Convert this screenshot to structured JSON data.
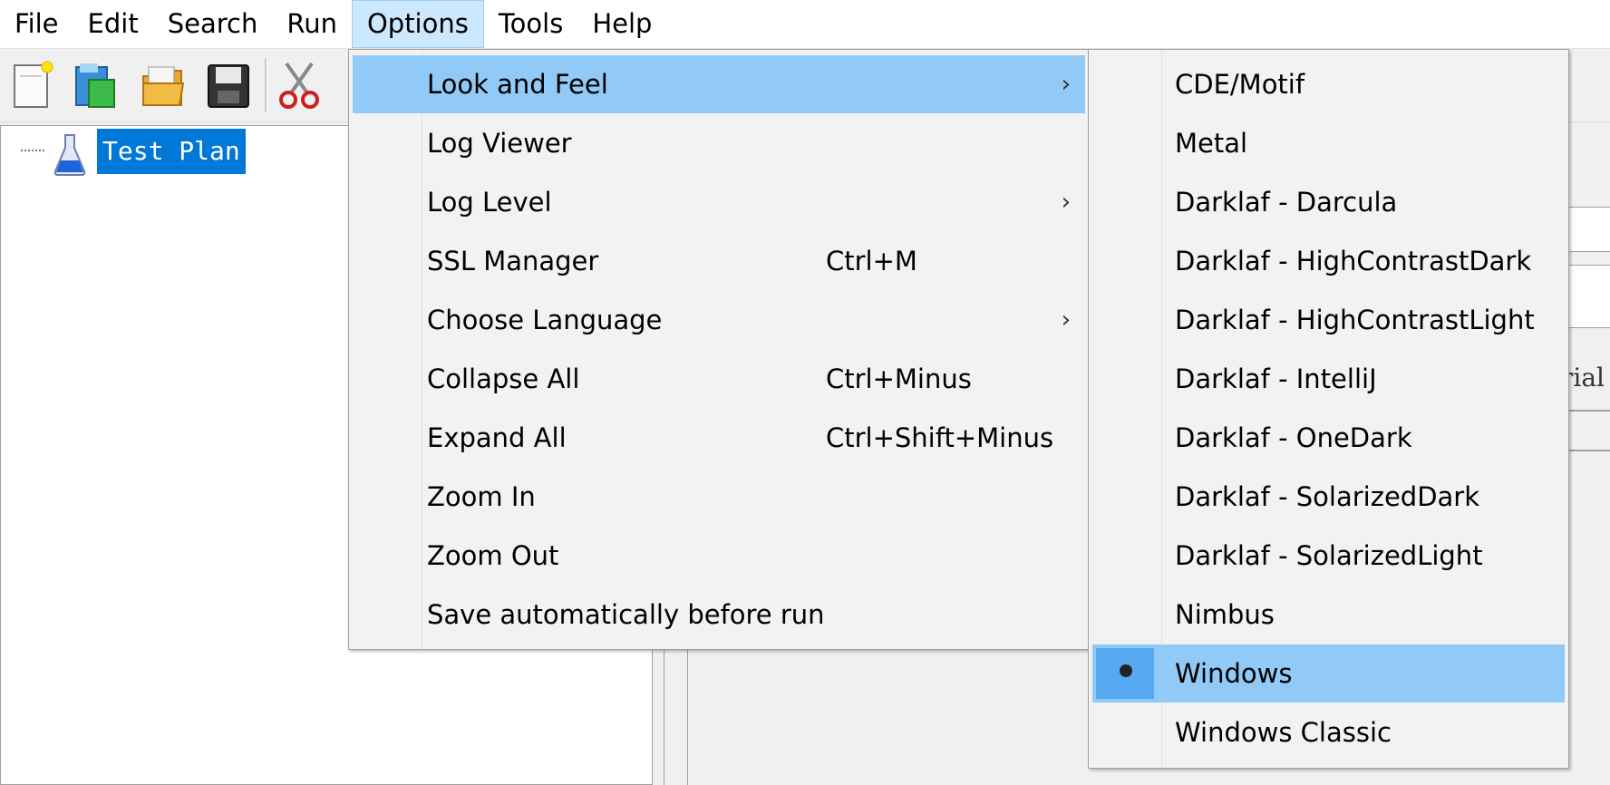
{
  "menubar": {
    "items": [
      {
        "label": "File"
      },
      {
        "label": "Edit"
      },
      {
        "label": "Search"
      },
      {
        "label": "Run"
      },
      {
        "label": "Options"
      },
      {
        "label": "Tools"
      },
      {
        "label": "Help"
      }
    ],
    "open_item": "Options"
  },
  "toolbar": {
    "icons": [
      "new-document-icon",
      "templates-icon",
      "open-folder-icon",
      "save-icon",
      "cut-icon"
    ]
  },
  "tree": {
    "root_label": "Test Plan",
    "root_icon": "flask-icon",
    "selected": true
  },
  "right_pane": {
    "partial_text": "rial"
  },
  "options_menu": {
    "items": [
      {
        "label": "Look and Feel",
        "shortcut": "",
        "submenu": true,
        "arrow": "›"
      },
      {
        "label": "Log Viewer",
        "shortcut": "",
        "submenu": false,
        "arrow": ""
      },
      {
        "label": "Log Level",
        "shortcut": "",
        "submenu": true,
        "arrow": "›"
      },
      {
        "label": "SSL Manager",
        "shortcut": "Ctrl+M",
        "submenu": false,
        "arrow": ""
      },
      {
        "label": "Choose Language",
        "shortcut": "",
        "submenu": true,
        "arrow": "›"
      },
      {
        "label": "Collapse All",
        "shortcut": "Ctrl+Minus",
        "submenu": false,
        "arrow": ""
      },
      {
        "label": "Expand All",
        "shortcut": "Ctrl+Shift+Minus",
        "submenu": false,
        "arrow": ""
      },
      {
        "label": "Zoom In",
        "shortcut": "",
        "submenu": false,
        "arrow": ""
      },
      {
        "label": "Zoom Out",
        "shortcut": "",
        "submenu": false,
        "arrow": ""
      },
      {
        "label": "Save automatically before run",
        "shortcut": "",
        "submenu": false,
        "arrow": ""
      }
    ],
    "highlighted": "Look and Feel"
  },
  "look_and_feel_menu": {
    "items": [
      {
        "label": "CDE/Motif"
      },
      {
        "label": "Metal"
      },
      {
        "label": "Darklaf - Darcula"
      },
      {
        "label": "Darklaf - HighContrastDark"
      },
      {
        "label": "Darklaf - HighContrastLight"
      },
      {
        "label": "Darklaf - IntelliJ"
      },
      {
        "label": "Darklaf - OneDark"
      },
      {
        "label": "Darklaf - SolarizedDark"
      },
      {
        "label": "Darklaf - SolarizedLight"
      },
      {
        "label": "Nimbus"
      },
      {
        "label": "Windows"
      },
      {
        "label": "Windows Classic"
      }
    ],
    "selected": "Windows"
  },
  "colors": {
    "menu_highlight": "#91c9f7",
    "tree_selection": "#0078d7",
    "radio_box": "#56a8f0"
  }
}
